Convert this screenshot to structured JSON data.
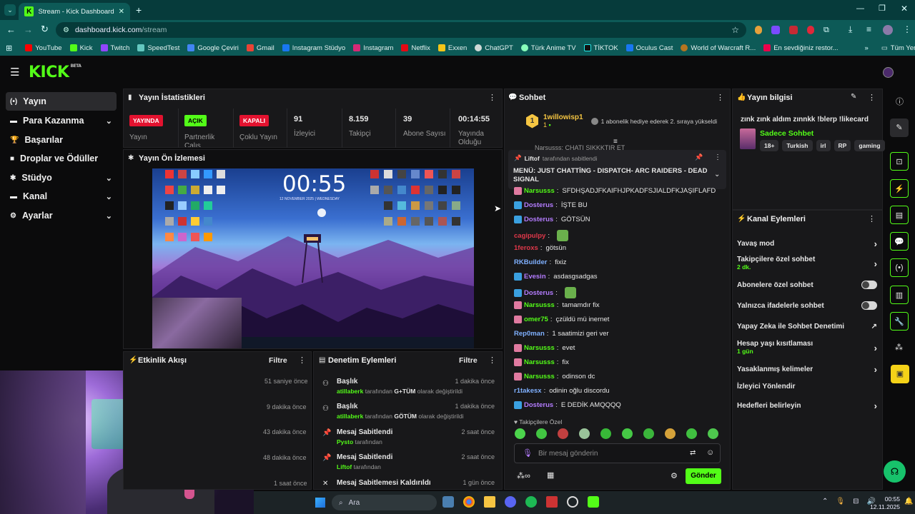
{
  "browser": {
    "tab_title": "Stream - Kick Dashboard",
    "url_domain": "dashboard.kick.com",
    "url_path": "/stream",
    "bookmarks": [
      "YouTube",
      "Kick",
      "Twitch",
      "SpeedTest",
      "Google Çeviri",
      "Gmail",
      "Instagram Stüdyo",
      "Instagram",
      "Netflix",
      "Exxen",
      "ChatGPT",
      "Türk Anime TV",
      "TİKTOK",
      "Oculus Cast",
      "World of Warcraft R...",
      "En sevdiğiniz restor..."
    ],
    "all_bookmarks": "Tüm Yer İşaretleri"
  },
  "header": {
    "logo": "KICK",
    "beta": "BETA"
  },
  "sidebar": {
    "items": [
      {
        "label": "Yayın"
      },
      {
        "label": "Para Kazanma"
      },
      {
        "label": "Başarılar"
      },
      {
        "label": "Droplar ve Ödüller"
      },
      {
        "label": "Stüdyo"
      },
      {
        "label": "Kanal"
      },
      {
        "label": "Ayarlar"
      }
    ]
  },
  "stats": {
    "title": "Yayın İstatistikleri",
    "cells": [
      {
        "badge": "YAYINDA",
        "label": "Yayın"
      },
      {
        "badge": "AÇIK",
        "label": "Partnerlik Çalış"
      },
      {
        "badge": "KAPALI",
        "label": "Çoklu Yayın"
      },
      {
        "value": "91",
        "label": "İzleyici"
      },
      {
        "value": "8.159",
        "label": "Takipçi"
      },
      {
        "value": "39",
        "label": "Abone Sayısı"
      },
      {
        "value": "00:14:55",
        "label": "Yayında Olduğu"
      }
    ]
  },
  "preview": {
    "title": "Yayın Ön İzlemesi",
    "clock": "00:55",
    "date": "12 NOVEMBER 2025 | WEDNESDAY"
  },
  "activity": {
    "title": "Etkinlik Akışı",
    "filter": "Filtre",
    "times": [
      "51 saniye önce",
      "9 dakika önce",
      "43 dakika önce",
      "48 dakika önce",
      "1 saat önce"
    ]
  },
  "moderation": {
    "title": "Denetim Eylemleri",
    "filter": "Filtre",
    "items": [
      {
        "title": "Başlık",
        "user": "atillaberk",
        "text": " tarafından ",
        "bold": "G+TÜM",
        "text2": " olarak değiştirildi",
        "time": "1 dakika önce"
      },
      {
        "title": "Başlık",
        "user": "atillaberk",
        "text": " tarafından ",
        "bold": "GÖTÜM",
        "text2": " olarak değiştirildi",
        "time": "1 dakika önce"
      },
      {
        "title": "Mesaj Sabitlendi",
        "user": "Pysto",
        "text": " tarafından",
        "bold": "",
        "text2": "",
        "time": "2 saat önce"
      },
      {
        "title": "Mesaj Sabitlendi",
        "user": "Liftof",
        "text": " tarafından",
        "bold": "",
        "text2": "",
        "time": "2 saat önce"
      },
      {
        "title": "Mesaj Sabitlemesi Kaldırıldı",
        "user": "",
        "text": "",
        "bold": "",
        "text2": "",
        "time": "1 gün önce"
      }
    ]
  },
  "chat": {
    "title": "Sohbet",
    "gift_user": "1willowisp1",
    "gift_count": "1",
    "gift_text": "1 abonelik hediye ederek 2. sıraya yükseldi",
    "cut_msg": "Narsusss: CHATI SIKKKTIR ET",
    "pinned_by": "Liftof",
    "pinned_by_text": "tarafından sabitlendi",
    "pinned_msg": "MENÜ: JUST CHATTİNG - DISPATCH- ARC RAIDERS - DEAD SIGNAL",
    "messages": [
      {
        "user": "Narsusss",
        "text": "SFDHŞADJFKAIFHJPKADFSJIALDFKJAŞIFLAFD",
        "color": "#53fc18"
      },
      {
        "user": "Dosterus",
        "text": "İŞTE BU",
        "color": "#b47cff"
      },
      {
        "user": "Dosterus",
        "text": "GÖTSÜN",
        "color": "#b47cff"
      },
      {
        "user": "cagipulpy",
        "text": "",
        "color": "#e0384a"
      },
      {
        "user": "1feroxs",
        "text": "götsün",
        "color": "#e0384a"
      },
      {
        "user": "RKBuilder",
        "text": "fixiz",
        "color": "#7fb0ff"
      },
      {
        "user": "Evesin",
        "text": "asdasgsadgas",
        "color": "#b47cff"
      },
      {
        "user": "Dosterus",
        "text": "",
        "color": "#b47cff"
      },
      {
        "user": "Narsusss",
        "text": "tamamdır fix",
        "color": "#53fc18"
      },
      {
        "user": "omer75",
        "text": "çzüldü mü inernet",
        "color": "#53fc18"
      },
      {
        "user": "Rep0man",
        "text": "1 saatimizi geri ver",
        "color": "#7fb0ff"
      },
      {
        "user": "Narsusss",
        "text": "evet",
        "color": "#53fc18"
      },
      {
        "user": "Narsusss",
        "text": "fix",
        "color": "#53fc18"
      },
      {
        "user": "Narsusss",
        "text": "odinson dc",
        "color": "#53fc18"
      },
      {
        "user": "r1takesx",
        "text": "odinin oğlu discordu",
        "color": "#7fb0ff"
      },
      {
        "user": "Dosterus",
        "text": "E DEDİK AMQQQQ",
        "color": "#b47cff"
      }
    ],
    "followers_only": "Takipçilere Özel",
    "input_placeholder": "Bir mesaj gönderin",
    "send": "Gönder"
  },
  "stream_info": {
    "title": "Yayın bilgisi",
    "stream_title": "zınk zınk aldım zınnkk !blerp !likecard",
    "category": "Sadece Sohbet",
    "tags": [
      "18+",
      "Turkish",
      "irl",
      "RP",
      "gaming"
    ]
  },
  "channel_actions": {
    "title": "Kanal Eylemleri",
    "rows": [
      {
        "label": "Yavaş mod",
        "sub": ""
      },
      {
        "label": "Takipçilere özel sohbet",
        "sub": "2 dk."
      },
      {
        "label": "Abonelere özel sohbet",
        "sub": ""
      },
      {
        "label": "Yalnızca ifadelerle sohbet",
        "sub": ""
      },
      {
        "label": "Yapay Zeka ile Sohbet Denetimi",
        "sub": ""
      },
      {
        "label": "Hesap yaşı kısıtlaması",
        "sub": "1 gün"
      },
      {
        "label": "Yasaklanmış kelimeler",
        "sub": ""
      },
      {
        "label": "İzleyici Yönlendir",
        "sub": ""
      },
      {
        "label": "Hedefleri belirleyin",
        "sub": ""
      }
    ]
  },
  "taskbar": {
    "search": "Ara",
    "time": "00:55",
    "date": "12.11.2025"
  },
  "colors": {
    "accent": "#53fc18",
    "live_red": "#e3122f"
  }
}
